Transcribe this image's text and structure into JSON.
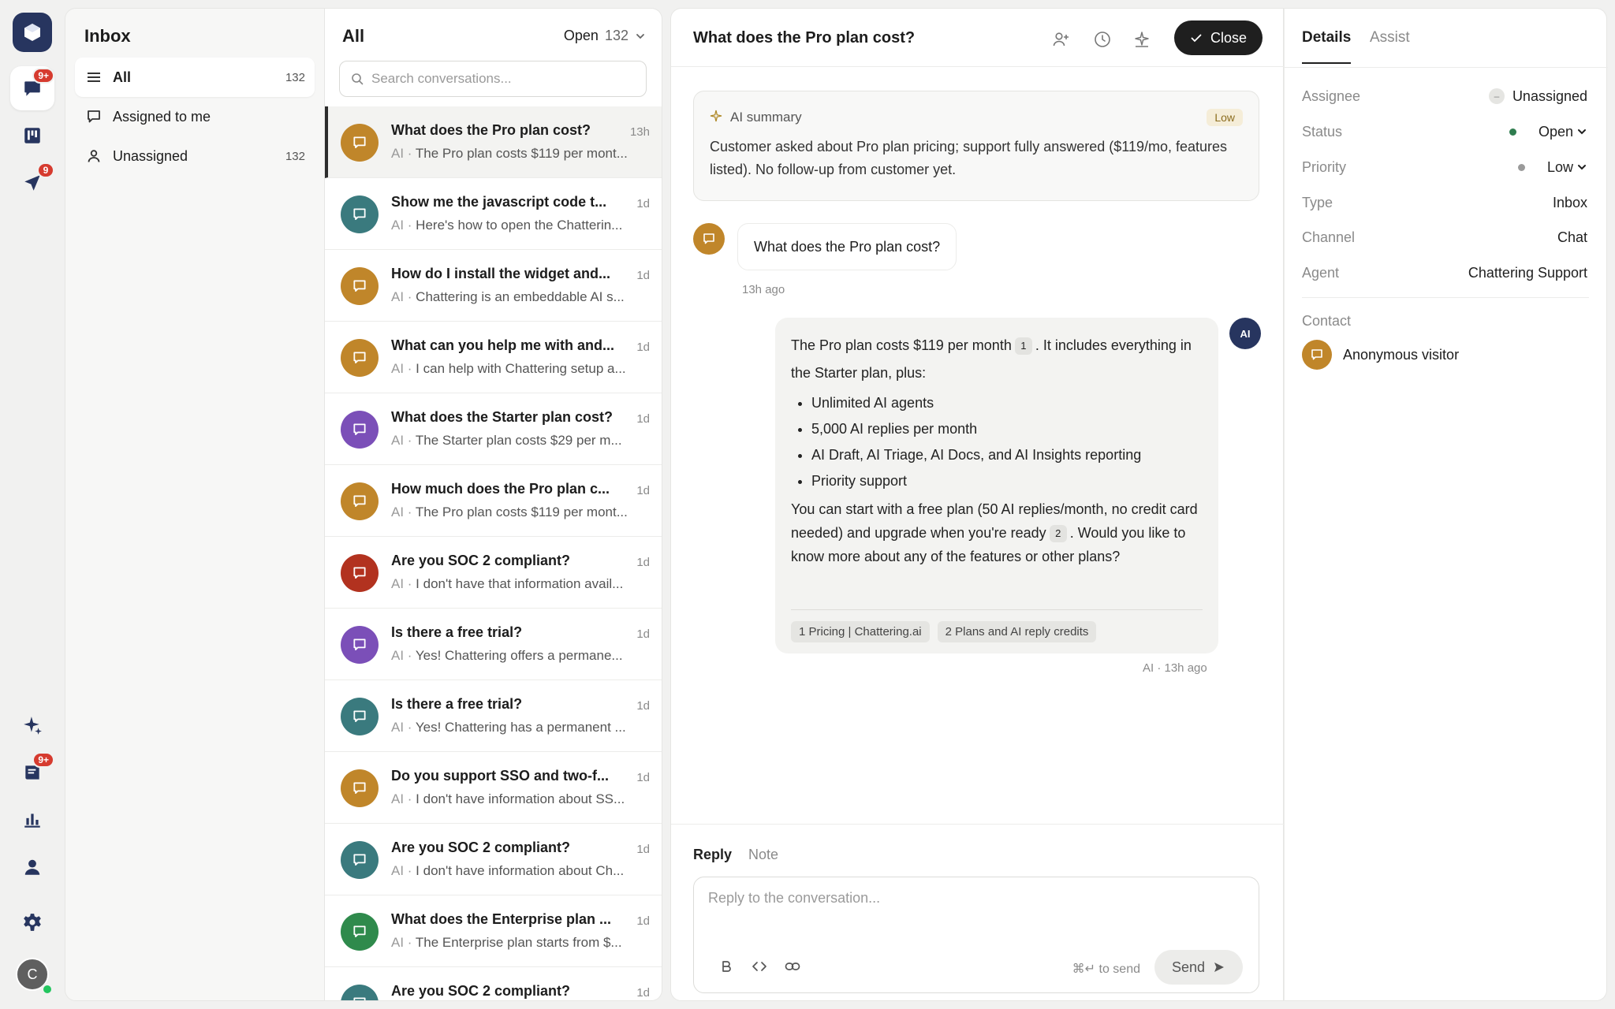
{
  "colors": {
    "brand": "#27355f",
    "badge": "#d63b2f",
    "avatar_orange": "#c0862a",
    "avatar_teal": "#3a7a7e",
    "avatar_purple": "#7b4fb8",
    "avatar_red": "#b2321f",
    "avatar_green": "#2f8a4c",
    "status_open": "#2f7d4f",
    "priority_low": "#9a9a9a"
  },
  "rail": {
    "icons": [
      "logo-icon",
      "chat-icon",
      "kanban-icon",
      "send-icon",
      "sparkle-icon",
      "book-icon",
      "chart-icon",
      "person-icon",
      "gear-icon"
    ],
    "chat_badge": "9+",
    "send_badge": "9",
    "book_badge": "9+",
    "avatar_initial": "C"
  },
  "inbox": {
    "title": "Inbox",
    "items": [
      {
        "label": "All",
        "count": "132",
        "icon": "list-icon"
      },
      {
        "label": "Assigned to me",
        "count": "",
        "icon": "message-icon"
      },
      {
        "label": "Unassigned",
        "count": "132",
        "icon": "user-icon"
      }
    ]
  },
  "list": {
    "title": "All",
    "filter_label": "Open",
    "filter_count": "132",
    "search_placeholder": "Search conversations...",
    "conversations": [
      {
        "title": "What does the Pro plan cost?",
        "time": "13h",
        "preview": "The Pro plan costs $119 per mont...",
        "color": "orange"
      },
      {
        "title": "Show me the javascript code t...",
        "time": "1d",
        "preview": "Here's how to open the Chatterin...",
        "color": "teal"
      },
      {
        "title": "How do I install the widget and...",
        "time": "1d",
        "preview": "Chattering is an embeddable AI s...",
        "color": "orange"
      },
      {
        "title": "What can you help me with and...",
        "time": "1d",
        "preview": "I can help with Chattering setup a...",
        "color": "orange"
      },
      {
        "title": "What does the Starter plan cost?",
        "time": "1d",
        "preview": "The Starter plan costs $29 per m...",
        "color": "purple"
      },
      {
        "title": "How much does the Pro plan c...",
        "time": "1d",
        "preview": "The Pro plan costs $119 per mont...",
        "color": "orange"
      },
      {
        "title": "Are you SOC 2 compliant?",
        "time": "1d",
        "preview": "I don't have that information avail...",
        "color": "red"
      },
      {
        "title": "Is there a free trial?",
        "time": "1d",
        "preview": "Yes! Chattering offers a permane...",
        "color": "purple"
      },
      {
        "title": "Is there a free trial?",
        "time": "1d",
        "preview": "Yes! Chattering has a permanent ...",
        "color": "teal"
      },
      {
        "title": "Do you support SSO and two-f...",
        "time": "1d",
        "preview": "I don't have information about SS...",
        "color": "orange"
      },
      {
        "title": "Are you SOC 2 compliant?",
        "time": "1d",
        "preview": "I don't have information about Ch...",
        "color": "teal"
      },
      {
        "title": "What does the Enterprise plan ...",
        "time": "1d",
        "preview": "The Enterprise plan starts from $...",
        "color": "green"
      },
      {
        "title": "Are you SOC 2 compliant?",
        "time": "1d",
        "preview": "",
        "color": "teal"
      }
    ],
    "ai_prefix": "AI · "
  },
  "main": {
    "title": "What does the Pro plan cost?",
    "close_label": "Close",
    "summary": {
      "label": "AI summary",
      "priority": "Low",
      "text": "Customer asked about Pro plan pricing; support fully answered ($119/mo, features listed). No follow-up from customer yet."
    },
    "customer_message": "What does the Pro plan cost?",
    "customer_time": "13h ago",
    "ai_avatar": "AI",
    "ai_message": {
      "p1a": "The Pro plan costs $119 per month",
      "cite1": "1",
      "p1b": ". It includes everything in the Starter plan, plus:",
      "bullets": [
        "Unlimited AI agents",
        "5,000 AI replies per month",
        "AI Draft, AI Triage, AI Docs, and AI Insights reporting",
        "Priority support"
      ],
      "p2a": "You can start with a free plan (50 AI replies/month, no credit card needed) and upgrade when you're ready",
      "cite2": "2",
      "p2b": ". Would you like to know more about any of the features or other plans?",
      "sources": [
        "1  Pricing | Chattering.ai",
        "2  Plans and AI reply credits"
      ]
    },
    "ai_time": "AI · 13h ago",
    "composer": {
      "tab_reply": "Reply",
      "tab_note": "Note",
      "placeholder": "Reply to the conversation...",
      "send_hint": "⌘↵ to send",
      "send_label": "Send"
    }
  },
  "details": {
    "tab_details": "Details",
    "tab_assist": "Assist",
    "rows": [
      {
        "label": "Assignee",
        "value": "Unassigned"
      },
      {
        "label": "Status",
        "value": "Open"
      },
      {
        "label": "Priority",
        "value": "Low"
      },
      {
        "label": "Type",
        "value": "Inbox"
      },
      {
        "label": "Channel",
        "value": "Chat"
      },
      {
        "label": "Agent",
        "value": "Chattering Support"
      }
    ],
    "contact_label": "Contact",
    "contact_name": "Anonymous visitor"
  }
}
